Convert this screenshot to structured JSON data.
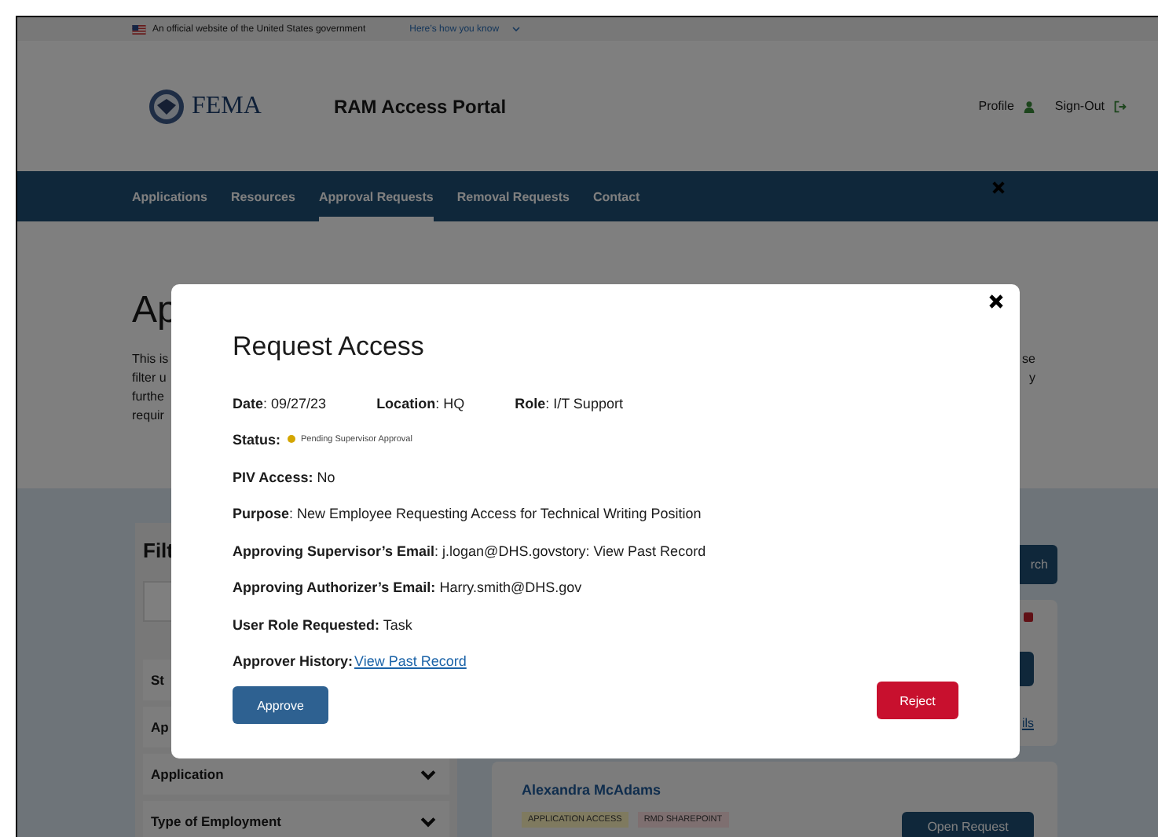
{
  "gov_banner": {
    "text": "An official website of the United States government",
    "link": "Here’s how you know"
  },
  "header": {
    "logo": "FEMA",
    "title": "RAM Access Portal",
    "links": [
      "Profile",
      "Sign-Out"
    ]
  },
  "nav": {
    "items": [
      {
        "label": "Applications",
        "selected": false
      },
      {
        "label": "Resources",
        "selected": false
      },
      {
        "label": "Approval Requests",
        "selected": true
      },
      {
        "label": "Removal Requests",
        "selected": false
      },
      {
        "label": "Contact",
        "selected": false
      }
    ]
  },
  "page": {
    "heading": "Ap",
    "intro_left": [
      "This is",
      "filter u",
      "furthe",
      "requir"
    ],
    "intro_right": [
      "se",
      "y"
    ]
  },
  "filters": {
    "title": "Filt",
    "items": [
      {
        "label": "St"
      },
      {
        "label": "Ap"
      },
      {
        "label": "Application"
      },
      {
        "label": "Type of Employment"
      }
    ]
  },
  "requests": {
    "search_button": "rch",
    "cards": [
      {
        "link": "ils"
      },
      {
        "name": "Alexandra McAdams",
        "tags": [
          {
            "label": "APPLICATION ACCESS",
            "color": "#7f7a5f"
          },
          {
            "label": "RMD SHAREPOINT",
            "color": "#7e6f70"
          }
        ],
        "button": "Open Request"
      }
    ]
  },
  "modal": {
    "title": "Request Access",
    "meta": [
      "**Date**: 09/27/23",
      "**Location**: HQ",
      "**Role**: I/T Support"
    ],
    "status": {
      "label": "Status:",
      "value": "Pending Supervisor Approval",
      "color": "#d4a600"
    },
    "fields": [
      "**PIV Access:** No",
      "**Purpose**: New Employee Requesting Access for Technical Writing Position",
      "**Approving Supervisor’s Email**: j.logan@DHS.govstory: View Past Record",
      "**Approving Authorizer’s Email:** Harry.smith@DHS.gov",
      "**User Role Requested:** Task"
    ],
    "history": {
      "label": "Approver History:",
      "link": "View Past Record"
    },
    "buttons": [
      {
        "label": "Approve",
        "kind": "primary"
      },
      {
        "label": "Reject",
        "kind": "danger"
      }
    ]
  }
}
